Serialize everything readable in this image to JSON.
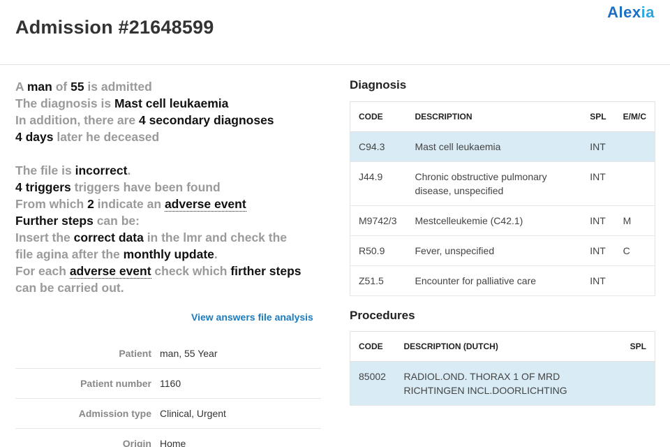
{
  "header": {
    "title": "Admission #21648599",
    "logo_main": "Alex",
    "logo_accent": "ia"
  },
  "summary": {
    "l1": [
      "A ",
      "man",
      " of ",
      "55",
      " is admitted"
    ],
    "l2": [
      "The diagnosis is ",
      "Mast cell leukaemia"
    ],
    "l3": [
      "In addition, there are ",
      "4 secondary diagnoses"
    ],
    "l4": [
      "4 days",
      " later he deceased"
    ],
    "l5": [
      "The file is ",
      "incorrect",
      "."
    ],
    "l6": [
      "4 triggers",
      " triggers have been found"
    ],
    "l7": [
      "From which ",
      "2",
      " indicate an ",
      "adverse event"
    ],
    "l8": [
      "Further steps",
      " can be:"
    ],
    "l9": [
      "Insert the ",
      "correct data",
      " in the lmr and check the"
    ],
    "l10": [
      "file agina after the ",
      "monthly update",
      "."
    ],
    "l11": [
      "For each ",
      "adverse event",
      " check which ",
      "firther steps"
    ],
    "l12": [
      "can be carried out."
    ]
  },
  "view_answers": "View answers file analysis",
  "info": [
    {
      "label": "Patient",
      "value": "man, 55 Year"
    },
    {
      "label": "Patient number",
      "value": "1160"
    },
    {
      "label": "Admission type",
      "value": "Clinical, Urgent"
    },
    {
      "label": "Origin",
      "value": "Home"
    }
  ],
  "diagnosis": {
    "title": "Diagnosis",
    "columns": [
      "CODE",
      "DESCRIPTION",
      "SPL",
      "E/M/C"
    ],
    "rows": [
      {
        "code": "C94.3",
        "description": "Mast cell leukaemia",
        "spl": "INT",
        "emc": ""
      },
      {
        "code": "J44.9",
        "description": "Chronic obstructive pulmonary disease, unspecified",
        "spl": "INT",
        "emc": ""
      },
      {
        "code": "M9742/3",
        "description": "Mestcelleukemie (C42.1)",
        "spl": "INT",
        "emc": "M"
      },
      {
        "code": "R50.9",
        "description": "Fever, unspecified",
        "spl": "INT",
        "emc": "C"
      },
      {
        "code": "Z51.5",
        "description": "Encounter for palliative care",
        "spl": "INT",
        "emc": ""
      }
    ]
  },
  "procedures": {
    "title": "Procedures",
    "columns": [
      "CODE",
      "DESCRIPTION (DUTCH)",
      "SPL"
    ],
    "rows": [
      {
        "code": "85002",
        "description": "RADIOL.OND. THORAX 1 OF MRD RICHTINGEN INCL.DOORLICHTING",
        "spl": ""
      }
    ]
  }
}
